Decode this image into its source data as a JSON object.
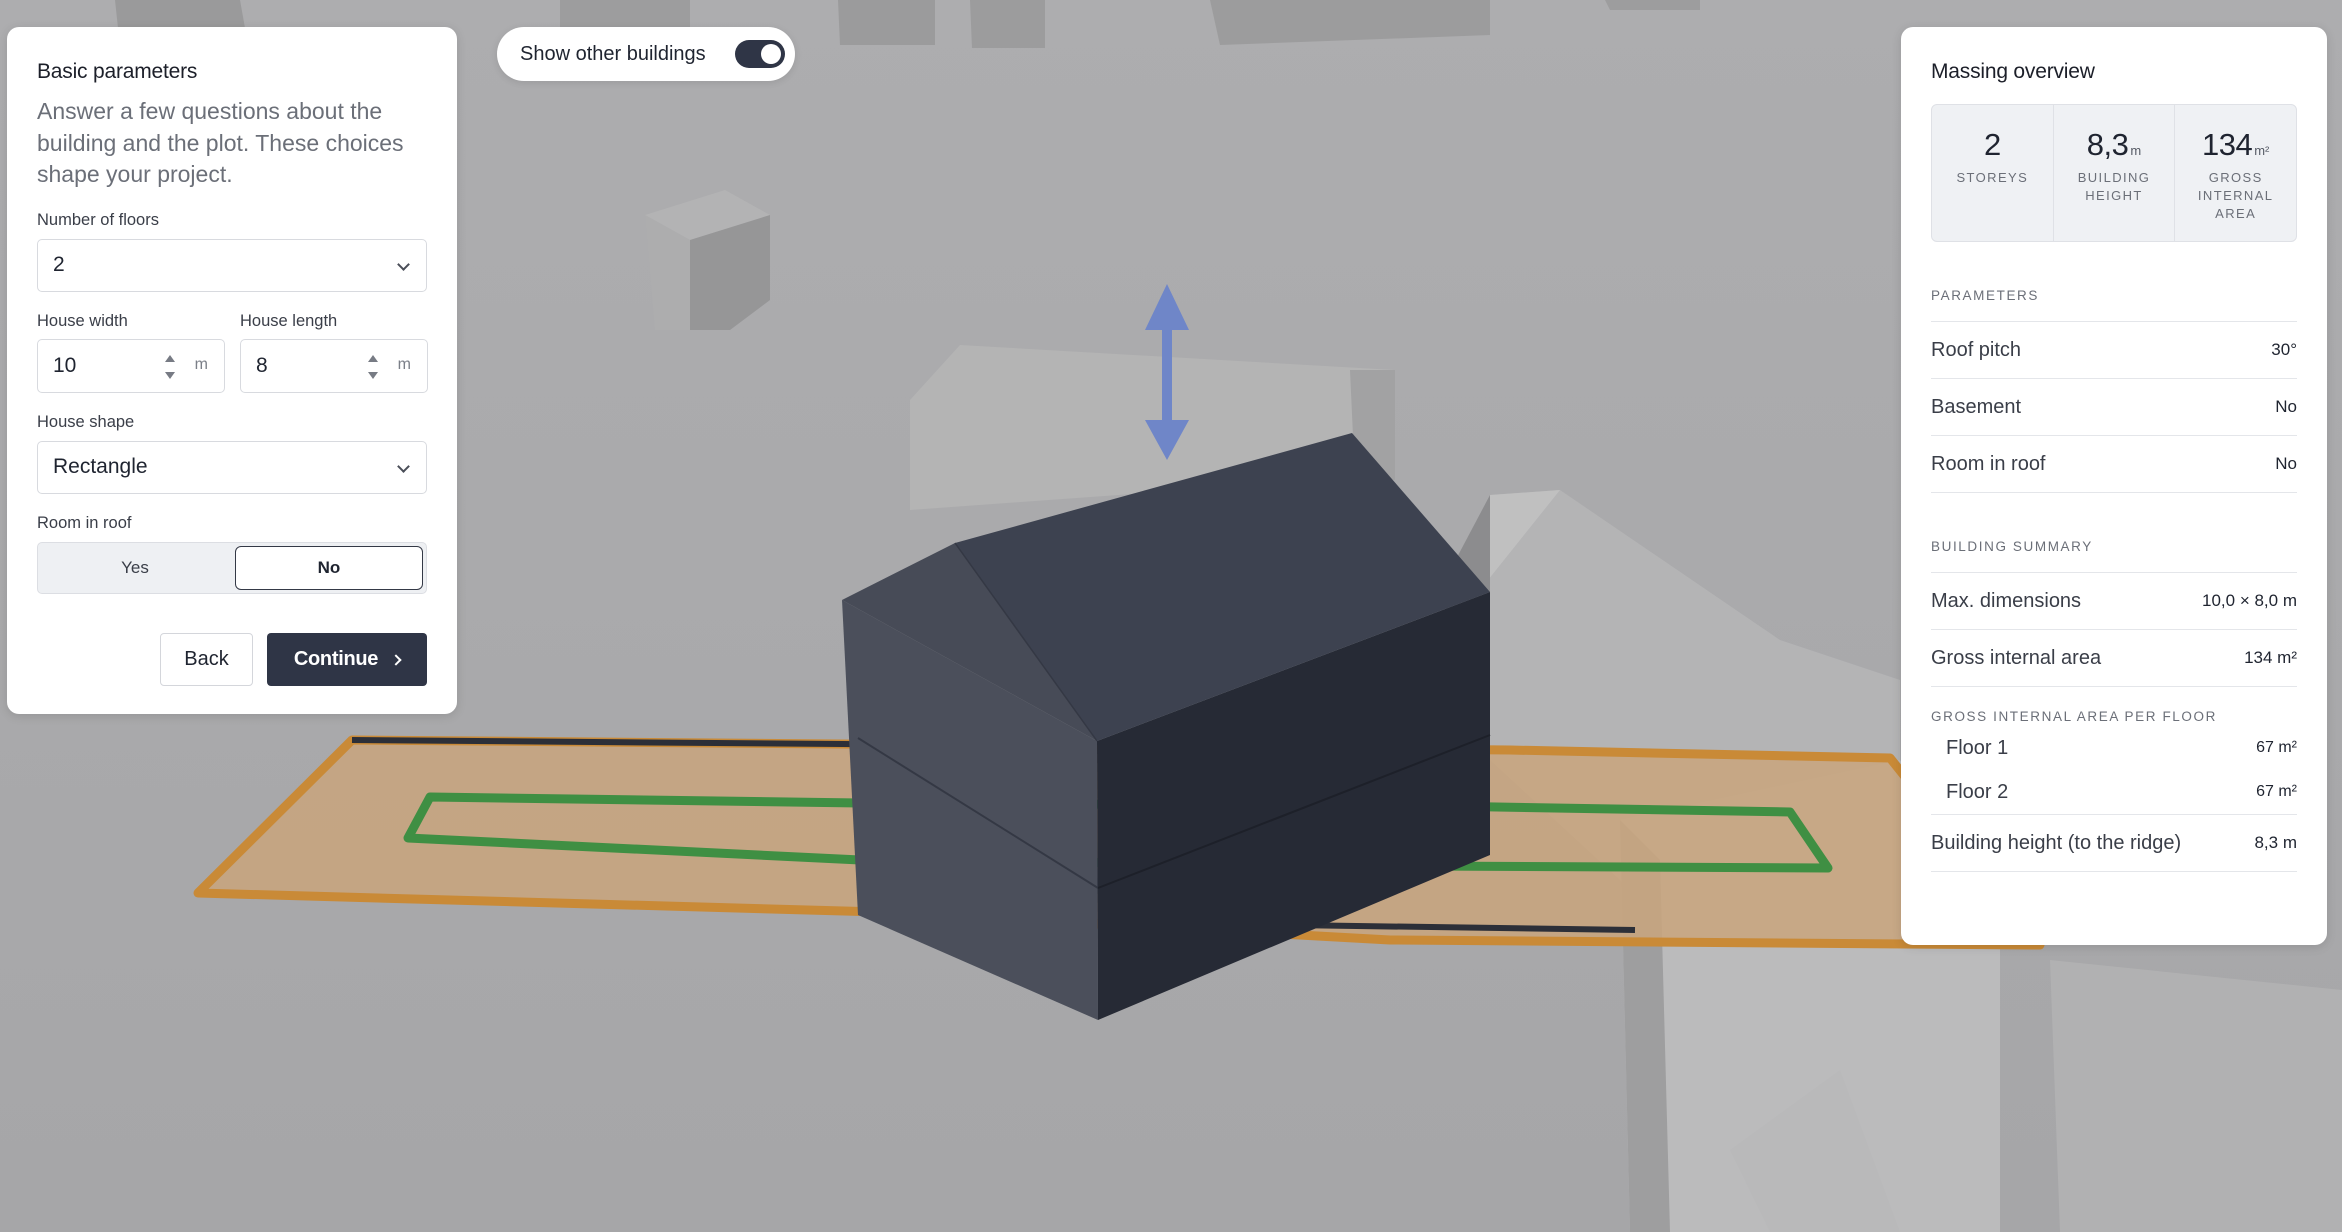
{
  "toggle": {
    "label": "Show other buildings",
    "on": true
  },
  "left_panel": {
    "title": "Basic parameters",
    "intro": "Answer a few questions about the building and the plot. These choices shape your project.",
    "floors": {
      "label": "Number of floors",
      "value": "2"
    },
    "width": {
      "label": "House width",
      "value": "10",
      "unit": "m"
    },
    "length": {
      "label": "House length",
      "value": "8",
      "unit": "m"
    },
    "shape": {
      "label": "House shape",
      "value": "Rectangle"
    },
    "room_in_roof": {
      "label": "Room in roof",
      "yes": "Yes",
      "no": "No",
      "selected": "No"
    },
    "back_label": "Back",
    "continue_label": "Continue"
  },
  "right_panel": {
    "title": "Massing overview",
    "stats": [
      {
        "value": "2",
        "unit": "",
        "label": "STOREYS"
      },
      {
        "value": "8,3",
        "unit": "m",
        "label": "BUILDING HEIGHT"
      },
      {
        "value": "134",
        "unit": "m²",
        "label": "GROSS INTERNAL AREA"
      }
    ],
    "parameters_heading": "PARAMETERS",
    "parameters": [
      {
        "label": "Roof pitch",
        "value": "30°"
      },
      {
        "label": "Basement",
        "value": "No"
      },
      {
        "label": "Room in roof",
        "value": "No"
      }
    ],
    "summary_heading": "BUILDING SUMMARY",
    "summary": [
      {
        "label": "Max. dimensions",
        "value": "10,0 × 8,0 m"
      },
      {
        "label": "Gross internal area",
        "value": "134 m²"
      }
    ],
    "per_floor_heading": "GROSS INTERNAL AREA PER FLOOR",
    "per_floor": [
      {
        "label": "Floor 1",
        "value": "67 m²"
      },
      {
        "label": "Floor 2",
        "value": "67 m²"
      }
    ],
    "height_row": {
      "label": "Building height (to the ridge)",
      "value": "8,3 m"
    }
  },
  "colors": {
    "accent_dark": "#2f3546",
    "plot_outline": "#c98a37",
    "plot_fill": "#c9a57c",
    "footprint_outline": "#3f8f43",
    "height_arrow": "#6f86c8",
    "building_top": "#3d4250",
    "building_left": "#4b4f5b",
    "building_right": "#262a35"
  }
}
